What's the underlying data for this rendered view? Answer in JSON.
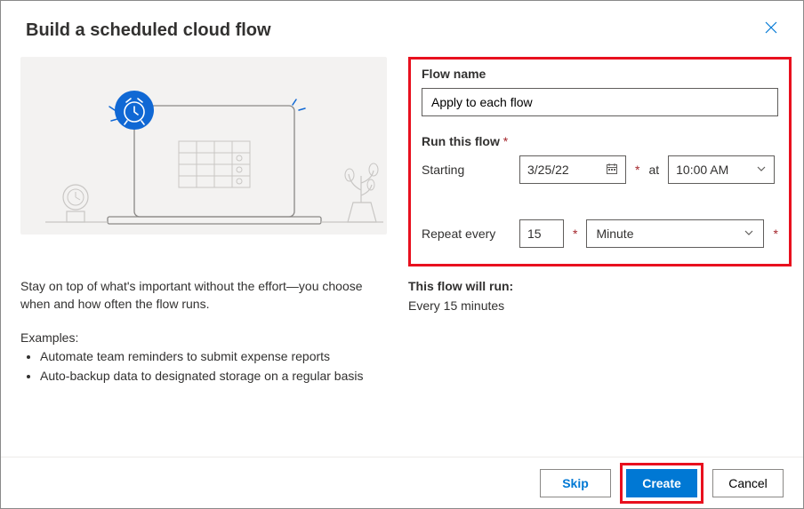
{
  "header": {
    "title": "Build a scheduled cloud flow"
  },
  "left": {
    "description": "Stay on top of what's important without the effort—you choose when and how often the flow runs.",
    "examples_label": "Examples:",
    "examples": [
      "Automate team reminders to submit expense reports",
      "Auto-backup data to designated storage on a regular basis"
    ]
  },
  "form": {
    "flow_name_label": "Flow name",
    "flow_name_value": "Apply to each flow",
    "run_label": "Run this flow ",
    "starting_label": "Starting",
    "starting_date": "3/25/22",
    "at_label": "at",
    "starting_time": "10:00 AM",
    "repeat_label": "Repeat every",
    "repeat_value": "15",
    "repeat_unit": "Minute"
  },
  "summary": {
    "label": "This flow will run:",
    "text": "Every 15 minutes"
  },
  "footer": {
    "skip": "Skip",
    "create": "Create",
    "cancel": "Cancel"
  }
}
